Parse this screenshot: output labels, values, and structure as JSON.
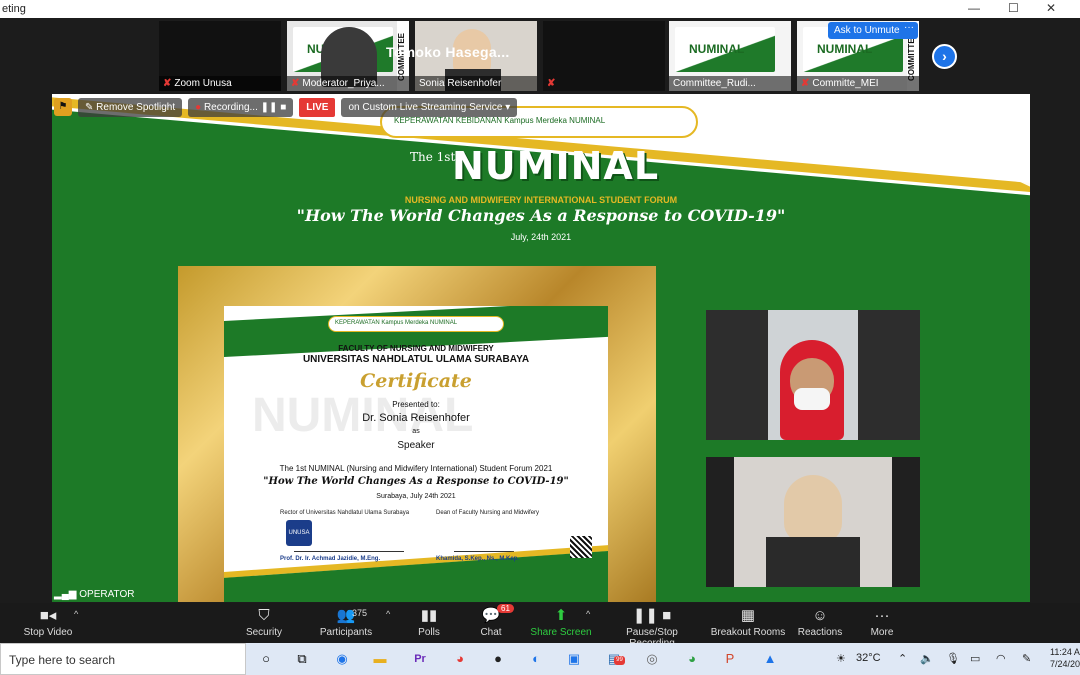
{
  "window": {
    "title": "eting",
    "controls": [
      "—",
      "☐",
      "✕"
    ]
  },
  "thumbnails": [
    {
      "name": "Zoom Unusa",
      "muted": true
    },
    {
      "name": "Moderator_Priya...",
      "muted": true,
      "tag": "COMMITTEE"
    },
    {
      "name": "Sonia Reisenhofer",
      "muted": false
    },
    {
      "name": "Tomoko  Hasega...",
      "muted": true
    },
    {
      "name": "Committee_Rudi...",
      "muted": false
    },
    {
      "name": "Committe_MEI",
      "muted": true,
      "tag": "COMMITTEE"
    }
  ],
  "ask_to_unmute": "Ask to Unmute",
  "more_dots": "···",
  "share_bar": {
    "remove_spotlight": "Remove Spotlight",
    "recording": "Recording...",
    "live": "LIVE",
    "streaming": "on Custom Live Streaming Service"
  },
  "banner": {
    "sponsor_text": "KEPERAWATAN  KEBIDANAN   Kampus Merdeka   NUMINAL",
    "the": "The 1st",
    "title": "NUMINAL",
    "subtitle": "NURSING AND MIDWIFERY INTERNATIONAL STUDENT FORUM",
    "theme": "\"How The World Changes As a Response to COVID-19\"",
    "date": "July, 24th 2021"
  },
  "certificate": {
    "sponsor_text": "KEPERAWATAN  Kampus Merdeka  NUMINAL",
    "faculty": "FACULTY OF NURSING AND MIDWIFERY",
    "university": "UNIVERSITAS NAHDLATUL ULAMA SURABAYA",
    "heading": "Certificate",
    "presented": "Presented to:",
    "recipient": "Dr. Sonia  Reisenhofer",
    "as": "as",
    "role": "Speaker",
    "event": "The 1st NUMINAL (Nursing and Midwifery International) Student Forum 2021",
    "theme": "\"How The World Changes As a Response to COVID-19\"",
    "place_date": "Surabaya, July 24th 2021",
    "watermark": "NUMINAL",
    "sig_left_title": "Rector of Universitas Nahdlatul Ulama Surabaya",
    "sig_left_name": "Prof. Dr. Ir. Achmad Jazidie, M.Eng.",
    "sig_right_title": "Dean of Faculty Nursing and Midwifery",
    "sig_right_name": "Khamida, S.Kep., Ns., M.Kep.",
    "logo": "UNUSA"
  },
  "operator": "OPERATOR",
  "toolbar": {
    "stop_video": "Stop Video",
    "security": "Security",
    "participants": "Participants",
    "participants_count": "375",
    "polls": "Polls",
    "chat": "Chat",
    "chat_badge": "61",
    "share_screen": "Share Screen",
    "pause_recording": "Pause/Stop Recording",
    "breakout": "Breakout Rooms",
    "reactions": "Reactions",
    "more": "More"
  },
  "taskbar": {
    "search_placeholder": "Type here to search",
    "temperature": "32°C",
    "time": "11:24 A",
    "date": "7/24/20",
    "badge_99": "99"
  },
  "colors": {
    "zoom_blue": "#1e74e8",
    "numinal_green": "#1d7a27",
    "gold": "#e5b824",
    "live_red": "#e53935"
  }
}
